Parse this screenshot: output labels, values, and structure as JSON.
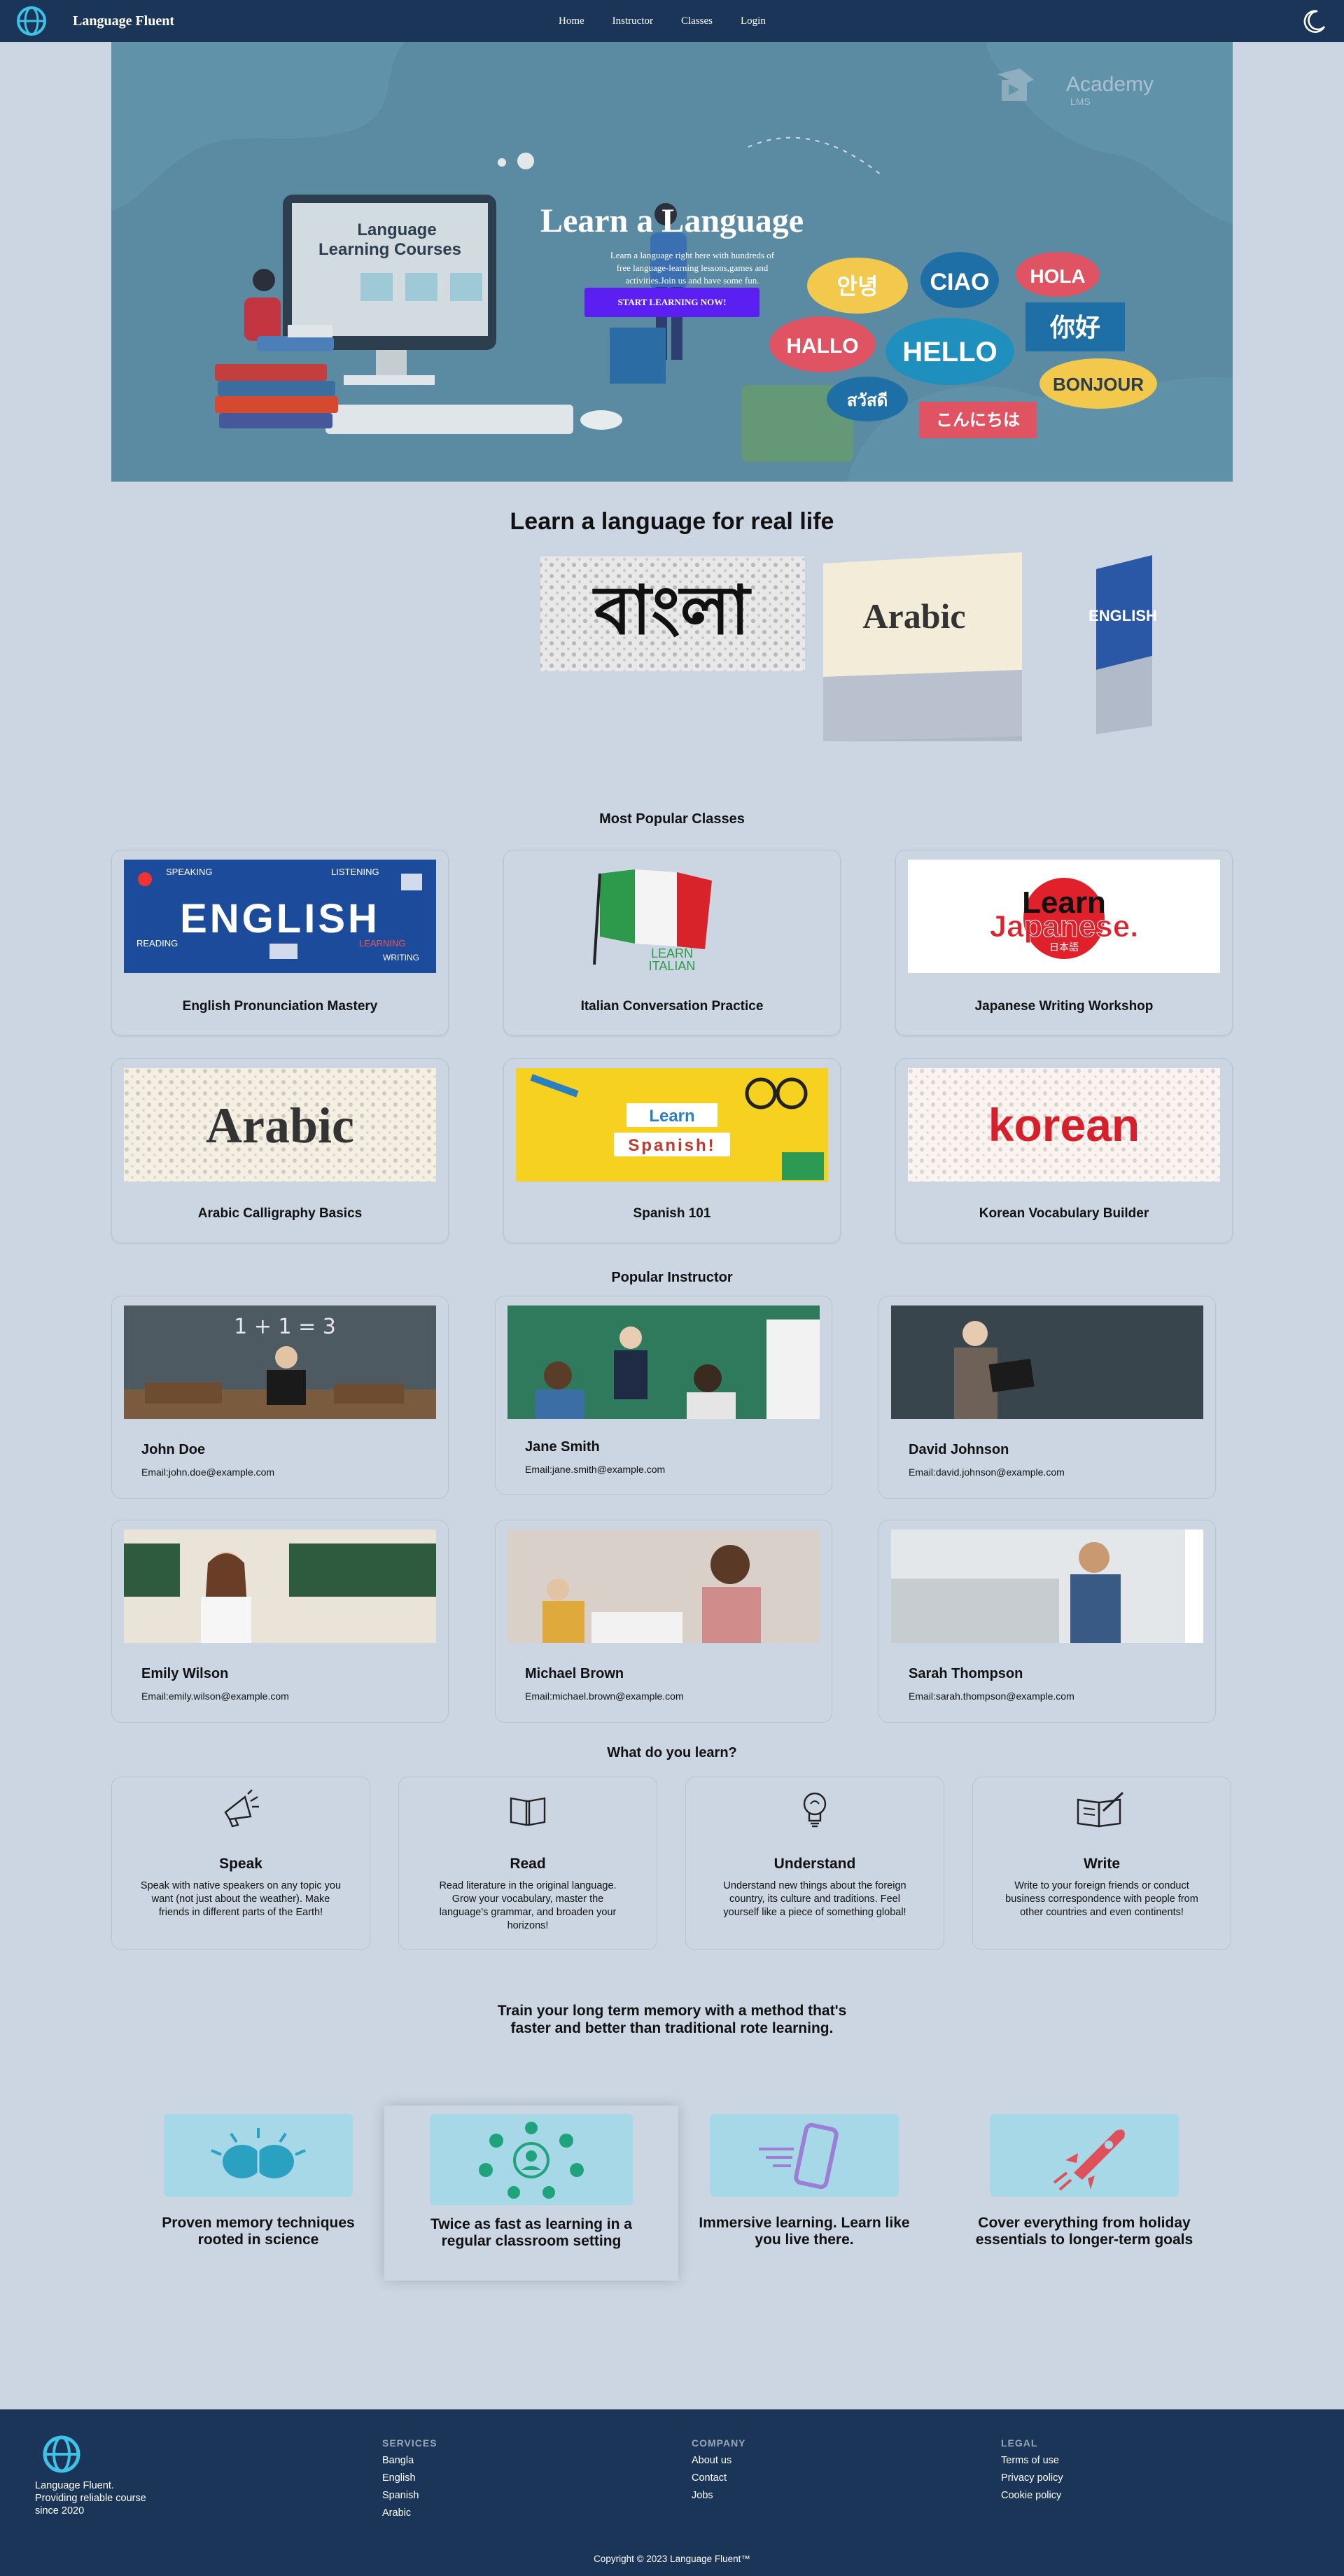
{
  "nav": {
    "brand": "Language Fluent",
    "links": [
      "Home",
      "Instructor",
      "Classes",
      "Login"
    ],
    "theme_icon": "moon-icon"
  },
  "hero": {
    "title": "Learn a Language",
    "subtitle": "Learn a language right here with hundreds of free language-learning lessons,games and activities.Join us and have some fun.",
    "cta": "START LEARNING NOW!",
    "academy_logo": "Academy",
    "academy_sub": "LMS",
    "screen_text_1": "Language",
    "screen_text_2": "Learning Courses",
    "bubbles": [
      "안녕",
      "CIAO",
      "HOLA",
      "HALLO",
      "HELLO",
      "你好",
      "BONJOUR",
      "สวัสดี",
      "こんにちは"
    ]
  },
  "carousel": {
    "heading": "Learn a language for real life",
    "slides": [
      "বাংলা",
      "Arabic",
      "ENGLISH"
    ],
    "dot_count": 13,
    "active_dot": 0
  },
  "classes": {
    "heading": "Most Popular Classes",
    "items": [
      {
        "title": "English Pronunciation Mastery",
        "art": "ENGLISH",
        "art_words": [
          "SPEAKING",
          "LISTENING",
          "READING",
          "LEARNING",
          "WRITING"
        ]
      },
      {
        "title": "Italian Conversation Practice",
        "art": "LEARN",
        "art2": "ITALIAN"
      },
      {
        "title": "Japanese Writing Workshop",
        "art": "Learn",
        "art2": "Japanese.",
        "art3": "日本語"
      },
      {
        "title": "Arabic Calligraphy Basics",
        "art": "Arabic"
      },
      {
        "title": "Spanish 101",
        "art": "Learn",
        "art2": "Spanish!"
      },
      {
        "title": "Korean Vocabulary Builder",
        "art": "korean"
      }
    ]
  },
  "instructors": {
    "heading": "Popular Instructor",
    "items": [
      {
        "name": "John Doe",
        "email": "Email:john.doe@example.com",
        "board": "1 + 1 = 3"
      },
      {
        "name": "Jane Smith",
        "email": "Email:jane.smith@example.com"
      },
      {
        "name": "David Johnson",
        "email": "Email:david.johnson@example.com"
      },
      {
        "name": "Emily Wilson",
        "email": "Email:emily.wilson@example.com"
      },
      {
        "name": "Michael Brown",
        "email": "Email:michael.brown@example.com"
      },
      {
        "name": "Sarah Thompson",
        "email": "Email:sarah.thompson@example.com"
      }
    ]
  },
  "learn": {
    "heading": "What do you learn?",
    "items": [
      {
        "icon": "megaphone-icon",
        "title": "Speak",
        "desc": "Speak with native speakers on any topic you want (not just about the weather). Make friends in different parts of the Earth!"
      },
      {
        "icon": "book-icon",
        "title": "Read",
        "desc": "Read literature in the original language. Grow your vocabulary, master the language's grammar, and broaden your horizons!"
      },
      {
        "icon": "lightbulb-icon",
        "title": "Understand",
        "desc": "Understand new things about the foreign country, its culture and traditions. Feel yourself like a piece of something global!"
      },
      {
        "icon": "write-icon",
        "title": "Write",
        "desc": "Write to your foreign friends or conduct business correspondence with people from other countries and even continents!"
      }
    ]
  },
  "method": {
    "heading_line1": "Train your long term memory with a method that's",
    "heading_line2": "faster and better than traditional rote learning.",
    "items": [
      {
        "icon": "brain-icon",
        "text": "Proven memory techniques rooted in science"
      },
      {
        "icon": "network-icon",
        "text": "Twice as fast as learning in a regular classroom setting"
      },
      {
        "icon": "phone-icon",
        "text": "Immersive learning. Learn like you live there."
      },
      {
        "icon": "rocket-icon",
        "text": "Cover everything from holiday essentials to longer-term goals"
      }
    ],
    "colors": {
      "box": "#a7d8e8",
      "brain": "#2aa1c0",
      "network": "#1fa37a",
      "phone": "#9b7fd4",
      "rocket": "#e0505a"
    }
  },
  "footer": {
    "tagline": "Language Fluent. Providing reliable course since 2020",
    "services": {
      "heading": "SERVICES",
      "links": [
        "Bangla",
        "English",
        "Spanish",
        "Arabic"
      ]
    },
    "company": {
      "heading": "COMPANY",
      "links": [
        "About us",
        "Contact",
        "Jobs"
      ]
    },
    "legal": {
      "heading": "LEGAL",
      "links": [
        "Terms of use",
        "Privacy policy",
        "Cookie policy"
      ]
    },
    "copyright": "Copyright © 2023 Language Fluent™"
  },
  "colors": {
    "nav_bg": "#1a3557",
    "page_bg": "#ccd6e3",
    "cta": "#5b1ff2",
    "logo": "#3ec3e6"
  }
}
